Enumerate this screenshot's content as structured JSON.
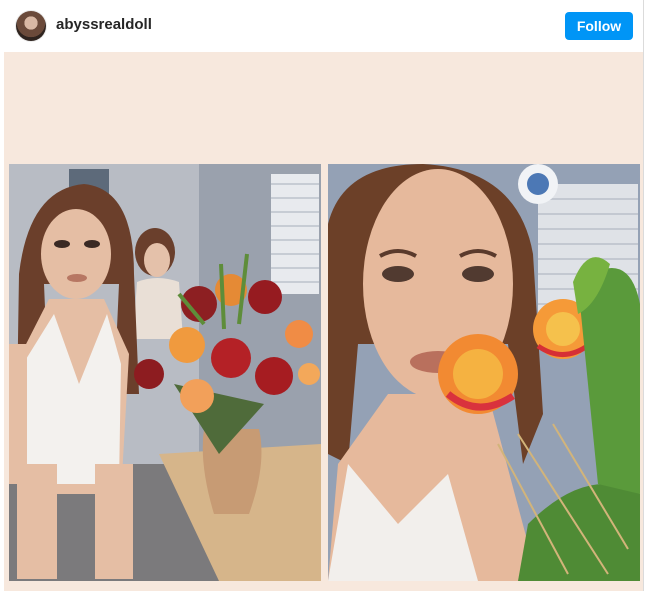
{
  "header": {
    "username": "abyssrealdoll",
    "follow_label": "Follow"
  },
  "icons": {
    "avatar": "profile-avatar-image"
  },
  "colors": {
    "follow_button": "#0095f6",
    "post_background": "#f7e8dd",
    "username_text": "#262626"
  }
}
